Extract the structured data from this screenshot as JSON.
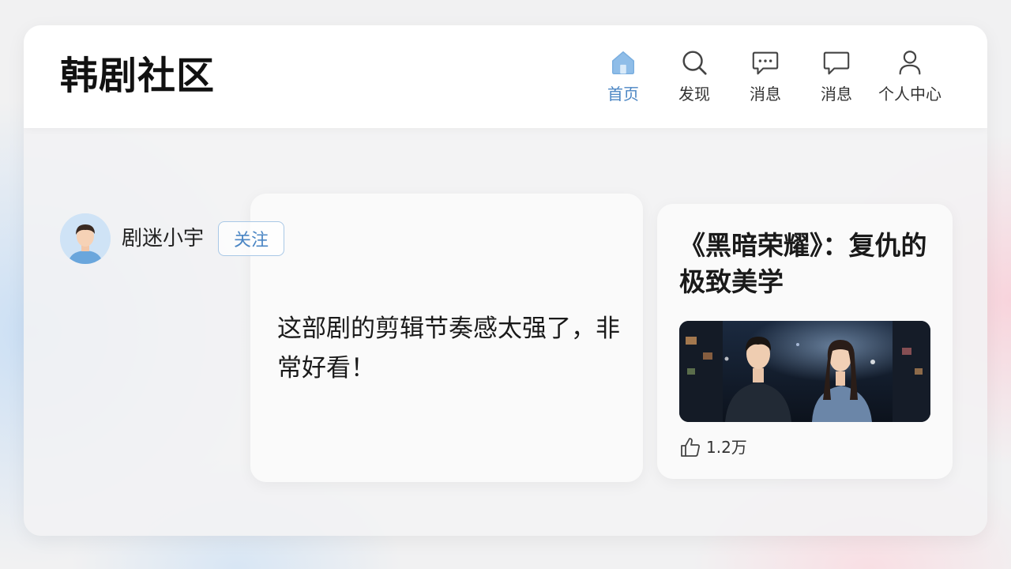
{
  "app": {
    "title": "韩剧社区"
  },
  "nav": {
    "items": [
      {
        "label": "首页",
        "icon": "home-icon",
        "active": true
      },
      {
        "label": "发现",
        "icon": "search-icon",
        "active": false
      },
      {
        "label": "消息",
        "icon": "chat-dots-icon",
        "active": false
      },
      {
        "label": "消息",
        "icon": "chat-bubble-icon",
        "active": false
      },
      {
        "label": "个人中心",
        "icon": "user-icon",
        "active": false
      }
    ]
  },
  "post": {
    "username": "剧迷小宇",
    "follow_label": "关注",
    "comment": "这部剧的剪辑节奏感太强了，非常好看！"
  },
  "article": {
    "title": "《黑暗荣耀》：复仇的极致美学",
    "likes": "1.2万"
  },
  "colors": {
    "accent": "#4b86c4",
    "active_icon": "#8fbde8"
  }
}
